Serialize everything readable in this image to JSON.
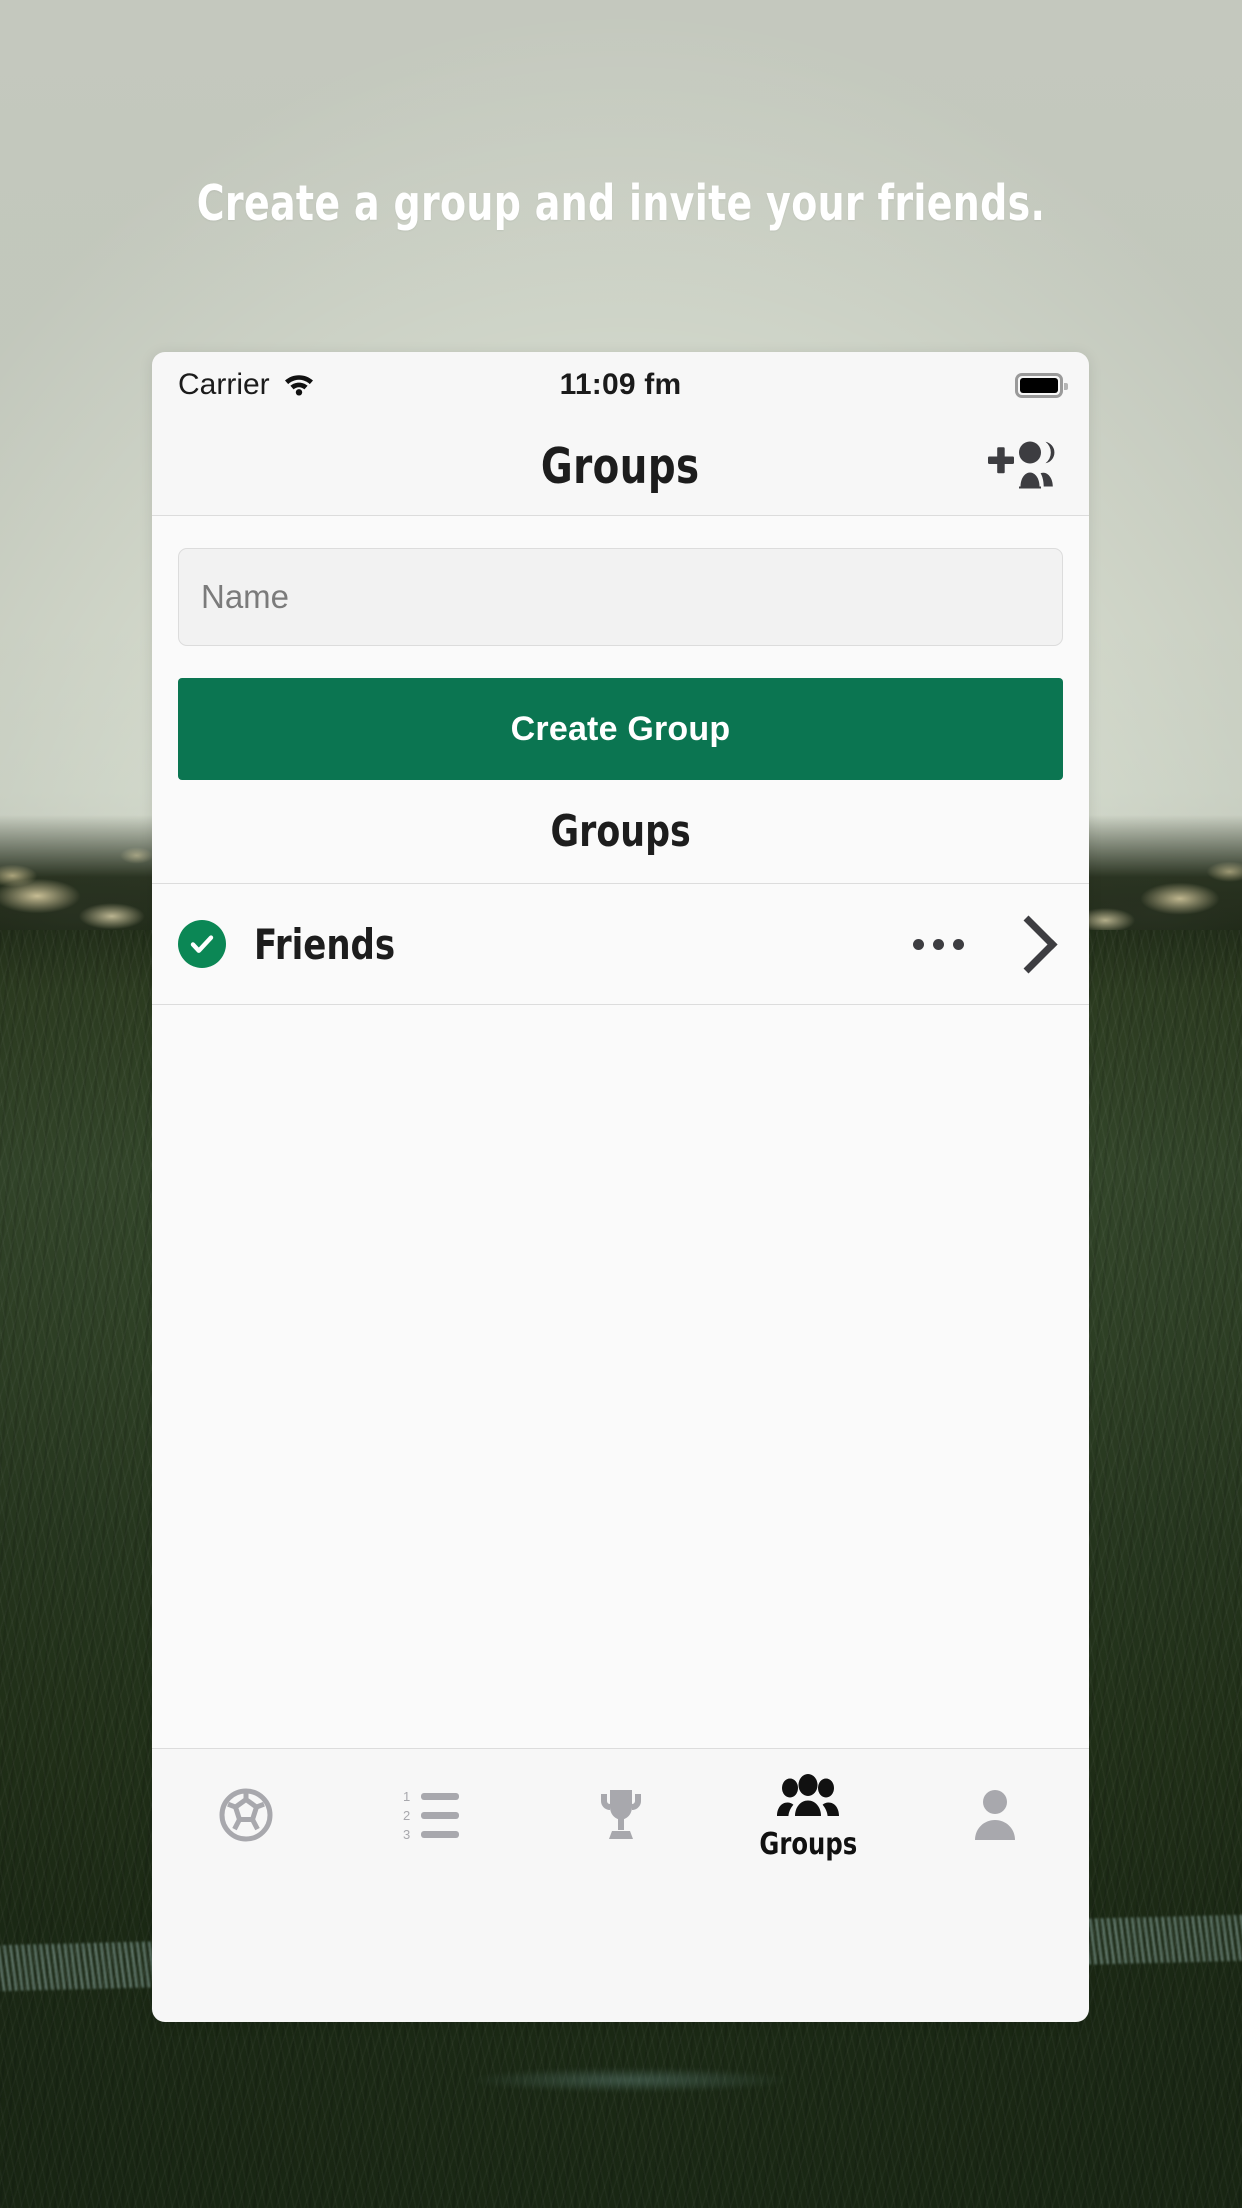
{
  "headline": "Create a group and invite your friends.",
  "colors": {
    "brand_green": "#0b7551",
    "check_green": "#0b8755",
    "icon_dark": "#3d3d41",
    "icon_muted": "#a8a8ad",
    "card_bg": "#fafafa",
    "chrome_bg": "#f7f7f7",
    "separator": "#dcdcdc"
  },
  "status_bar": {
    "carrier": "Carrier",
    "wifi_icon": "wifi-icon",
    "time": "11:09 fm",
    "battery_icon": "battery-full-icon"
  },
  "nav_bar": {
    "title": "Groups",
    "action_icon": "add-people-icon"
  },
  "form": {
    "name_field": {
      "placeholder": "Name",
      "value": ""
    },
    "create_button_label": "Create Group"
  },
  "list": {
    "section_header": "Groups",
    "rows": [
      {
        "status_icon": "check-circle-icon",
        "name": "Friends",
        "more_icon": "more-horizontal-icon",
        "disclosure_icon": "chevron-right-icon"
      }
    ]
  },
  "tab_bar": {
    "tabs": [
      {
        "icon": "soccer-ball-icon",
        "label": "",
        "active": false
      },
      {
        "icon": "numbered-list-icon",
        "label": "",
        "active": false
      },
      {
        "icon": "trophy-icon",
        "label": "",
        "active": false
      },
      {
        "icon": "people-icon",
        "label": "Groups",
        "active": true
      },
      {
        "icon": "person-icon",
        "label": "",
        "active": false
      }
    ]
  }
}
